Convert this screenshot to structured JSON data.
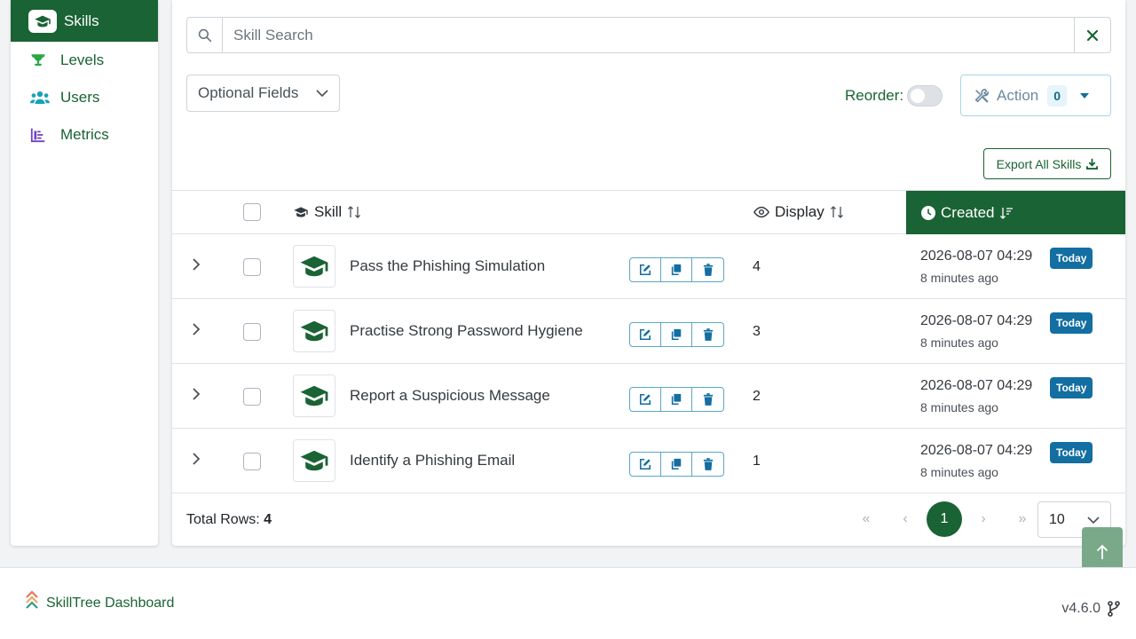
{
  "sidebar": {
    "items": [
      {
        "label": "Skills",
        "icon": "graduation-cap-icon"
      },
      {
        "label": "Levels",
        "icon": "trophy-icon"
      },
      {
        "label": "Users",
        "icon": "users-icon"
      },
      {
        "label": "Metrics",
        "icon": "chart-icon"
      }
    ]
  },
  "search": {
    "placeholder": "Skill Search"
  },
  "controls": {
    "optional_fields": "Optional Fields",
    "reorder_label": "Reorder:",
    "action_label": "Action",
    "action_count": "0",
    "export_label": "Export All Skills"
  },
  "table": {
    "headers": {
      "skill": "Skill",
      "display": "Display",
      "created": "Created"
    },
    "rows": [
      {
        "name": "Pass the Phishing Simulation",
        "display": "4",
        "date": "2026-08-07 04:29",
        "ago": "8 minutes ago",
        "badge": "Today"
      },
      {
        "name": "Practise Strong Password Hygiene",
        "display": "3",
        "date": "2026-08-07 04:29",
        "ago": "8 minutes ago",
        "badge": "Today"
      },
      {
        "name": "Report a Suspicious Message",
        "display": "2",
        "date": "2026-08-07 04:29",
        "ago": "8 minutes ago",
        "badge": "Today"
      },
      {
        "name": "Identify a Phishing Email",
        "display": "1",
        "date": "2026-08-07 04:29",
        "ago": "8 minutes ago",
        "badge": "Today"
      }
    ],
    "total_label": "Total Rows:",
    "total": "4",
    "current_page": "1",
    "per_page": "10"
  },
  "footer": {
    "brand": "SkillTree Dashboard",
    "version": "v4.6.0"
  },
  "colors": {
    "primary": "#1a6334",
    "info": "#136ea1"
  }
}
